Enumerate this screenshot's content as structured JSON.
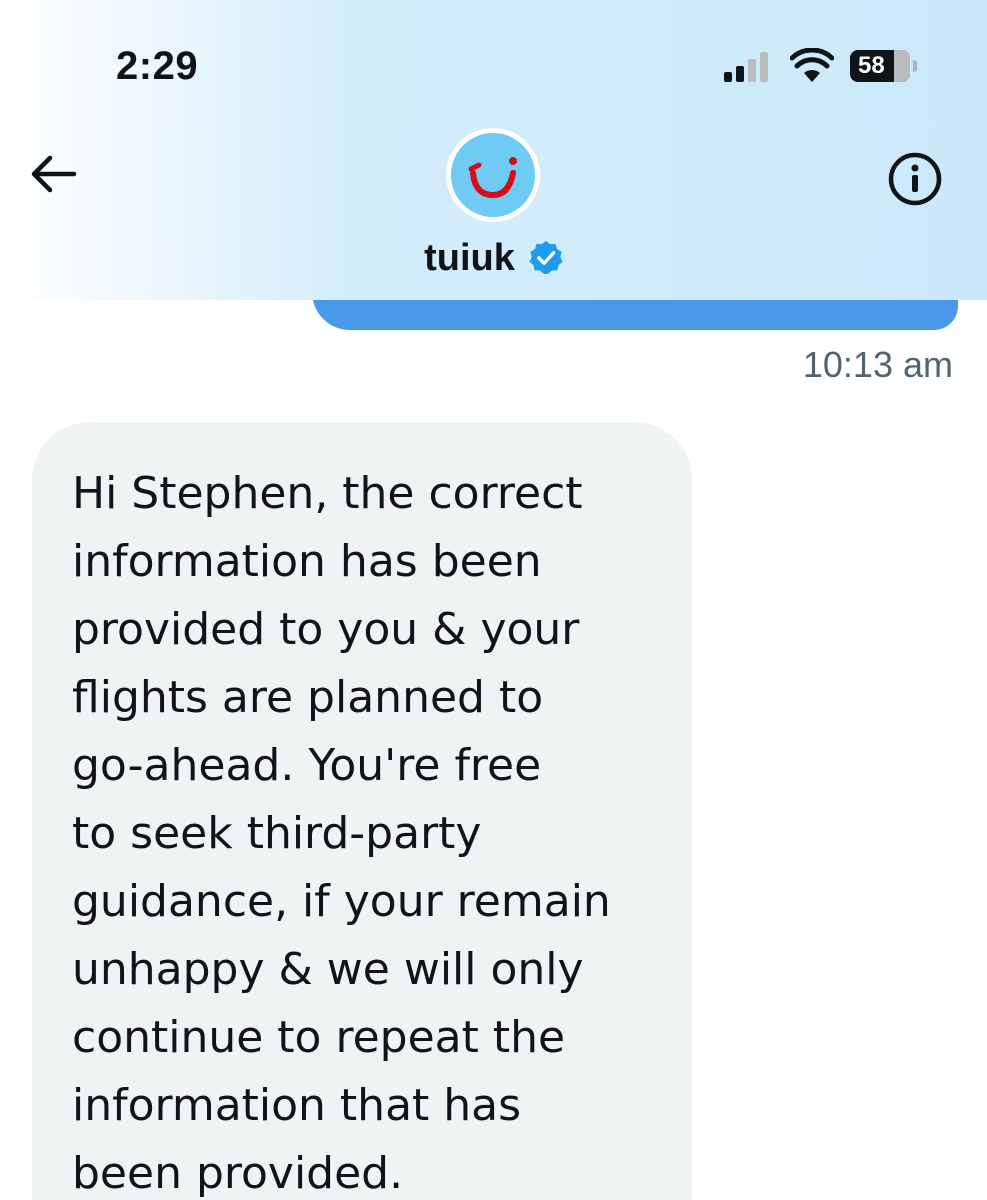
{
  "status_bar": {
    "time": "2:29",
    "battery": "58"
  },
  "conversation": {
    "username": "tuiuk",
    "verified": true,
    "avatar": "tui-smile-logo",
    "icons": [
      "back-arrow-icon",
      "info-icon",
      "verified-badge-icon"
    ]
  },
  "messages": [
    {
      "direction": "sent",
      "text": "",
      "timestamp": "10:13 am"
    },
    {
      "direction": "received",
      "text": "Hi Stephen, the correct\ninformation has been\nprovided to you & your\nflights are planned to\ngo-ahead.  You're free\nto seek third-party\nguidance, if your remain\nunhappy & we will only\ncontinue to repeat the\ninformation that has\nbeen provided."
    }
  ],
  "colors": {
    "sent_bubble": "#4a99e9",
    "received_bubble": "#eff3f4",
    "header_tint": "#cbe9fb",
    "verified": "#1d9bf0",
    "tui_red": "#d40e14"
  }
}
